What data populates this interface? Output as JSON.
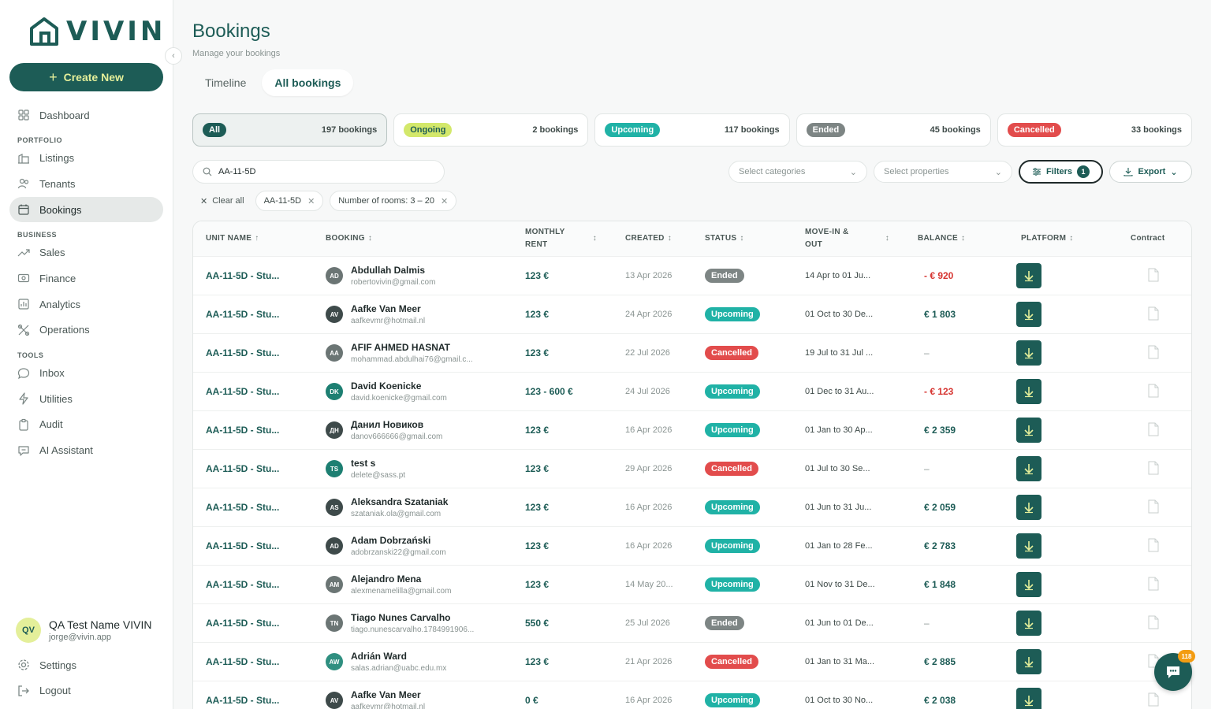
{
  "app": {
    "logo_text": "VIVIN",
    "brand_color": "#1d5c56",
    "accent_color": "#e4ef9a"
  },
  "sidebar": {
    "create_label": "Create New",
    "items": [
      {
        "label": "Dashboard",
        "icon": "dashboard-icon"
      },
      {
        "section": "PORTFOLIO"
      },
      {
        "label": "Listings",
        "icon": "listings-icon"
      },
      {
        "label": "Tenants",
        "icon": "tenants-icon"
      },
      {
        "label": "Bookings",
        "icon": "calendar-icon",
        "active": true
      },
      {
        "section": "BUSINESS"
      },
      {
        "label": "Sales",
        "icon": "trend-icon"
      },
      {
        "label": "Finance",
        "icon": "finance-icon"
      },
      {
        "label": "Analytics",
        "icon": "chart-icon"
      },
      {
        "label": "Operations",
        "icon": "tools-icon"
      },
      {
        "section": "TOOLS"
      },
      {
        "label": "Inbox",
        "icon": "chat-icon"
      },
      {
        "label": "Utilities",
        "icon": "bolt-icon"
      },
      {
        "label": "Audit",
        "icon": "clipboard-icon"
      },
      {
        "label": "AI Assistant",
        "icon": "ai-chat-icon"
      }
    ],
    "user": {
      "initials": "QV",
      "name": "QA Test Name VIVIN",
      "email": "jorge@vivin.app"
    },
    "settings_label": "Settings",
    "logout_label": "Logout"
  },
  "header": {
    "title": "Bookings",
    "subtitle": "Manage your bookings"
  },
  "tabs": [
    {
      "label": "Timeline"
    },
    {
      "label": "All bookings",
      "active": true
    }
  ],
  "stats": [
    {
      "label": "All",
      "count": "197 bookings",
      "color": "#1d5c56",
      "text": "#ffffff",
      "active": true
    },
    {
      "label": "Ongoing",
      "count": "2 bookings",
      "color": "#d3e86b",
      "text": "#1d5c56"
    },
    {
      "label": "Upcoming",
      "count": "117 bookings",
      "color": "#20b2a6",
      "text": "#ffffff"
    },
    {
      "label": "Ended",
      "count": "45 bookings",
      "color": "#7d8584",
      "text": "#ffffff"
    },
    {
      "label": "Cancelled",
      "count": "33 bookings",
      "color": "#e24c4c",
      "text": "#ffffff"
    }
  ],
  "search": {
    "value": "AA-11-5D",
    "placeholder": "Search"
  },
  "selects": {
    "categories": "Select categories",
    "properties": "Select properties"
  },
  "filters": {
    "label": "Filters",
    "count": "1"
  },
  "export": {
    "label": "Export"
  },
  "chips": {
    "clear_all": "Clear all",
    "items": [
      "AA-11-5D",
      "Number of rooms: 3 – 20"
    ]
  },
  "table": {
    "headers": {
      "unit": "UNIT NAME",
      "booking": "BOOKING",
      "rent": "MONTHLY\nRENT",
      "created": "CREATED",
      "status": "STATUS",
      "move": "MOVE-IN &\nOUT",
      "balance": "BALANCE",
      "platform": "PLATFORM",
      "contract": "Contract"
    },
    "rows": [
      {
        "unit": "AA-11-5D - Stu...",
        "initials": "AD",
        "avcolor": "#6b7574",
        "name": "Abdullah Dalmis",
        "email": "robertovivin@gmail.com",
        "rent": "123 €",
        "created": "13 Apr 2026",
        "status": "Ended",
        "move": "14 Apr to 01 Ju...",
        "balance": "- € 920",
        "bal_type": "neg"
      },
      {
        "unit": "AA-11-5D - Stu...",
        "initials": "AV",
        "avcolor": "#3e4a4a",
        "name": "Aafke Van Meer",
        "email": "aafkevmr@hotmail.nl",
        "rent": "123 €",
        "created": "24 Apr 2026",
        "status": "Upcoming",
        "move": "01 Oct to 30 De...",
        "balance": "€ 1 803",
        "bal_type": "pos"
      },
      {
        "unit": "AA-11-5D - Stu...",
        "initials": "AA",
        "avcolor": "#6b7574",
        "name": "AFIF AHMED HASNAT",
        "email": "mohammad.abdulhai76@gmail.c...",
        "rent": "123 €",
        "created": "22 Jul 2026",
        "status": "Cancelled",
        "move": "19 Jul to 31 Jul ...",
        "balance": "–",
        "bal_type": "none"
      },
      {
        "unit": "AA-11-5D - Stu...",
        "initials": "DK",
        "avcolor": "#1d7f72",
        "name": "David Koenicke",
        "email": "david.koenicke@gmail.com",
        "rent": "123 - 600 €",
        "created": "24 Jul 2026",
        "status": "Upcoming",
        "move": "01 Dec to 31 Au...",
        "balance": "- € 123",
        "bal_type": "neg"
      },
      {
        "unit": "AA-11-5D - Stu...",
        "initials": "ДН",
        "avcolor": "#3e4a4a",
        "name": "Данил Новиков",
        "email": "danov666666@gmail.com",
        "rent": "123 €",
        "created": "16 Apr 2026",
        "status": "Upcoming",
        "move": "01 Jan to 30 Ap...",
        "balance": "€ 2 359",
        "bal_type": "pos"
      },
      {
        "unit": "AA-11-5D - Stu...",
        "initials": "TS",
        "avcolor": "#1d7f72",
        "name": "test s",
        "email": "delete@sass.pt",
        "rent": "123 €",
        "created": "29 Apr 2026",
        "status": "Cancelled",
        "move": "01 Jul to 30 Se...",
        "balance": "–",
        "bal_type": "none"
      },
      {
        "unit": "AA-11-5D - Stu...",
        "initials": "AS",
        "avcolor": "#3e4a4a",
        "name": "Aleksandra Szataniak",
        "email": "szataniak.ola@gmail.com",
        "rent": "123 €",
        "created": "16 Apr 2026",
        "status": "Upcoming",
        "move": "01 Jun to 31 Ju...",
        "balance": "€ 2 059",
        "bal_type": "pos"
      },
      {
        "unit": "AA-11-5D - Stu...",
        "initials": "AD",
        "avcolor": "#3e4a4a",
        "name": "Adam Dobrzański",
        "email": "adobrzanski22@gmail.com",
        "rent": "123 €",
        "created": "16 Apr 2026",
        "status": "Upcoming",
        "move": "01 Jan to 28 Fe...",
        "balance": "€ 2 783",
        "bal_type": "pos"
      },
      {
        "unit": "AA-11-5D - Stu...",
        "initials": "AM",
        "avcolor": "#6b7574",
        "name": "Alejandro Mena",
        "email": "alexmenamelilla@gmail.com",
        "rent": "123 €",
        "created": "14 May 20...",
        "status": "Upcoming",
        "move": "01 Nov to 31 De...",
        "balance": "€ 1 848",
        "bal_type": "pos"
      },
      {
        "unit": "AA-11-5D - Stu...",
        "initials": "TN",
        "avcolor": "#6b7574",
        "name": "Tiago Nunes Carvalho",
        "email": "tiago.nunescarvalho.1784991906...",
        "rent": "550 €",
        "created": "25 Jul 2026",
        "status": "Ended",
        "move": "01 Jun to 01 De...",
        "balance": "–",
        "bal_type": "none"
      },
      {
        "unit": "AA-11-5D - Stu...",
        "initials": "AW",
        "avcolor": "#2f8f80",
        "name": "Adrián Ward",
        "email": "salas.adrian@uabc.edu.mx",
        "rent": "123 €",
        "created": "21 Apr 2026",
        "status": "Cancelled",
        "move": "01 Jan to 31 Ma...",
        "balance": "€ 2 885",
        "bal_type": "pos"
      },
      {
        "unit": "AA-11-5D - Stu...",
        "initials": "AV",
        "avcolor": "#3e4a4a",
        "name": "Aafke Van Meer",
        "email": "aafkevmr@hotmail.nl",
        "rent": "0 €",
        "created": "16 Apr 2026",
        "status": "Upcoming",
        "move": "01 Oct to 30 No...",
        "balance": "€ 2 038",
        "bal_type": "pos"
      }
    ]
  },
  "chat": {
    "badge": "118"
  }
}
